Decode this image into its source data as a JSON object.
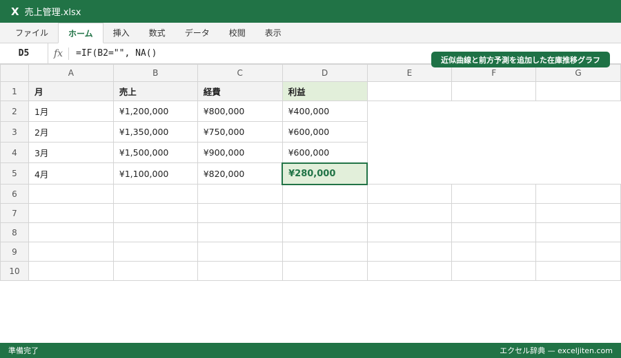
{
  "window": {
    "logo": "X",
    "title": "売上管理.xlsx"
  },
  "ribbon": {
    "tabs": [
      "ファイル",
      "ホーム",
      "挿入",
      "数式",
      "データ",
      "校閲",
      "表示"
    ],
    "active": "ホーム"
  },
  "formula_bar": {
    "cell_ref": "D5",
    "fx_label": "fx",
    "formula": "=IF(B2=\"\", NA()"
  },
  "badge": {
    "text": "近似曲線と前方予測を追加した在庫推移グラフ"
  },
  "sheet": {
    "columns": [
      "A",
      "B",
      "C",
      "D",
      "E",
      "F",
      "G"
    ],
    "rows": [
      "1",
      "2",
      "3",
      "4",
      "5",
      "6",
      "7",
      "8",
      "9",
      "10"
    ],
    "header": [
      "月",
      "売上",
      "経費",
      "利益"
    ],
    "data": [
      [
        "1月",
        "¥1,200,000",
        "¥800,000",
        "¥400,000"
      ],
      [
        "2月",
        "¥1,350,000",
        "¥750,000",
        "¥600,000"
      ],
      [
        "3月",
        "¥1,500,000",
        "¥900,000",
        "¥600,000"
      ],
      [
        "4月",
        "¥1,100,000",
        "¥820,000",
        "¥280,000"
      ]
    ],
    "selected_cell": "D5"
  },
  "status": {
    "left": "準備完了",
    "right": "エクセル辞典 — exceljiten.com"
  },
  "colors": {
    "accent": "#217346",
    "selected_fill": "#e2efda"
  }
}
